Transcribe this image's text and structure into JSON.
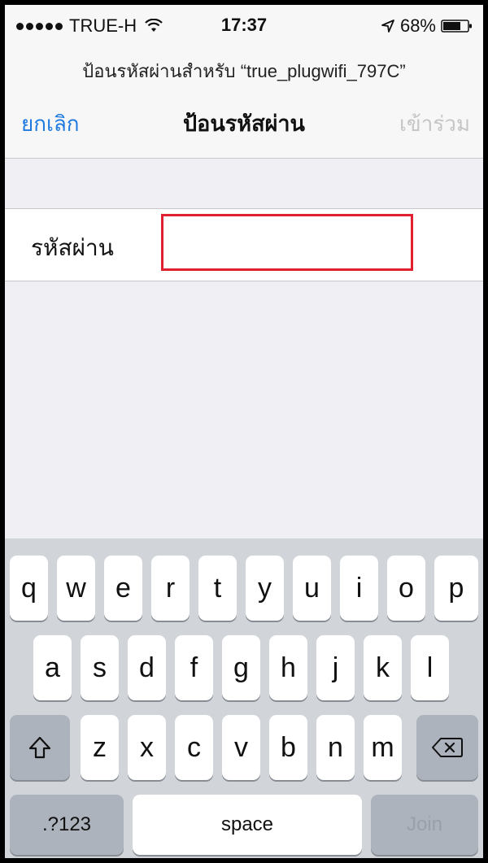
{
  "status_bar": {
    "carrier": "TRUE-H",
    "time": "17:37",
    "battery": "68%"
  },
  "header": {
    "prompt": "ป้อนรหัสผ่านสำหรับ “true_plugwifi_797C”",
    "cancel_label": "ยกเลิก",
    "title": "ป้อนรหัสผ่าน",
    "join_label": "เข้าร่วม"
  },
  "form": {
    "password_label": "รหัสผ่าน",
    "password_value": ""
  },
  "keyboard": {
    "row1": [
      "q",
      "w",
      "e",
      "r",
      "t",
      "y",
      "u",
      "i",
      "o",
      "p"
    ],
    "row2": [
      "a",
      "s",
      "d",
      "f",
      "g",
      "h",
      "j",
      "k",
      "l"
    ],
    "row3": [
      "z",
      "x",
      "c",
      "v",
      "b",
      "n",
      "m"
    ],
    "numbers_label": ".?123",
    "space_label": "space",
    "join_label": "Join"
  },
  "colors": {
    "accent": "#1f7ae0",
    "input_highlight": "#e02030",
    "keyboard_bg": "#d1d4d9"
  }
}
